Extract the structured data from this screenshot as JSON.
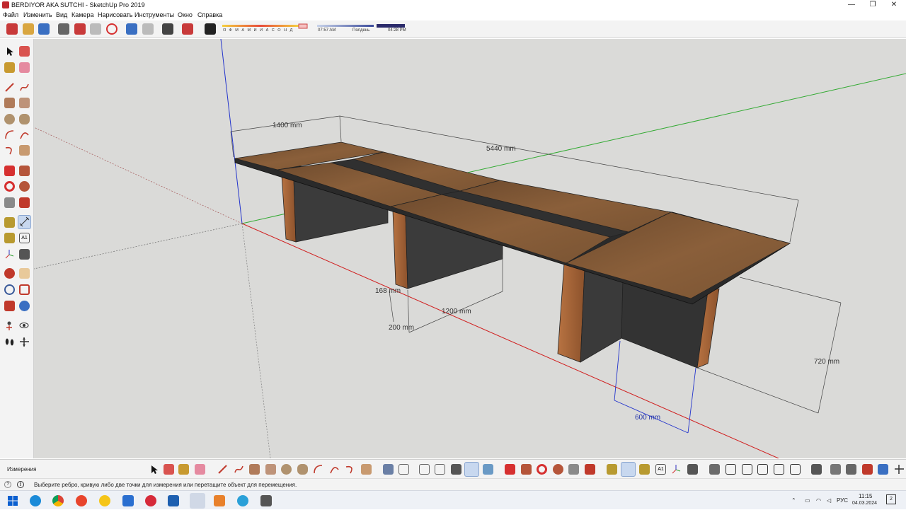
{
  "window": {
    "title": "BERDIYOR AKA SUTCHI - SketchUp Pro 2019",
    "minimize": "—",
    "maximize": "❐",
    "close": "✕"
  },
  "menu": [
    "Файл",
    "Изменить",
    "Вид",
    "Камера",
    "Нарисовать",
    "Инструменты",
    "Окно",
    "Справка"
  ],
  "shadow": {
    "months": "Я Ф М А М И И А С О Н Д",
    "time_start": "07:57 AM",
    "time_mid": "Полдень",
    "time_end": "04:28 PM"
  },
  "dimensions": {
    "width": "1400 mm",
    "length": "5440 mm",
    "leg_thickness": "168 mm",
    "leg_inset": "200 mm",
    "leg_depth": "1200 mm",
    "base_width": "600 mm",
    "height": "720 mm"
  },
  "measurements_label": "Измерения",
  "status": "Выберите ребро, кривую либо две точки для измерения или перетащите объект для перемещения.",
  "tray": {
    "language": "РУС",
    "time": "11:15",
    "date": "04.03.2024",
    "notifications": "2"
  },
  "colors": {
    "wood": "#7a5433",
    "leg_dark": "#3a3a3a",
    "leg_wood": "#a8683a",
    "axis_red": "#d02020",
    "axis_green": "#33aa33",
    "axis_blue": "#2233cc",
    "sky": "#dadad8"
  }
}
